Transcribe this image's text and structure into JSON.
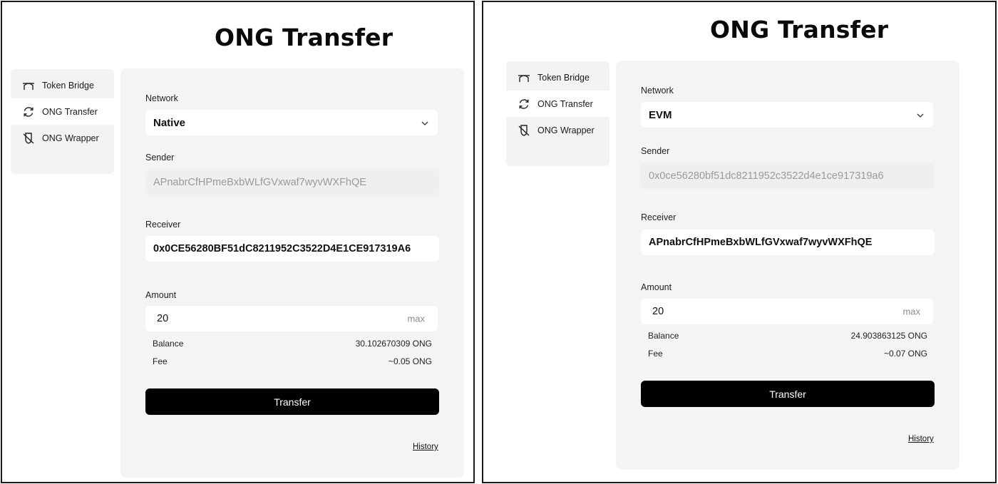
{
  "panels": [
    {
      "title": "ONG Transfer",
      "sidebar": [
        {
          "label": "Token Bridge",
          "icon": "bridge-icon"
        },
        {
          "label": "ONG Transfer",
          "icon": "refresh-icon"
        },
        {
          "label": "ONG Wrapper",
          "icon": "wrapper-icon"
        }
      ],
      "network_label": "Network",
      "network_value": "Native",
      "sender_label": "Sender",
      "sender_value": "APnabrCfHPmeBxbWLfGVxwaf7wyvWXFhQE",
      "receiver_label": "Receiver",
      "receiver_value": "0x0CE56280BF51dC8211952C3522D4E1CE917319A6",
      "amount_label": "Amount",
      "amount_value": "20",
      "max_label": "max",
      "balance_label": "Balance",
      "balance_value": "30.102670309 ONG",
      "fee_label": "Fee",
      "fee_value": "~0.05 ONG",
      "transfer_label": "Transfer",
      "history_label": "History"
    },
    {
      "title": "ONG Transfer",
      "sidebar": [
        {
          "label": "Token Bridge",
          "icon": "bridge-icon"
        },
        {
          "label": "ONG Transfer",
          "icon": "refresh-icon"
        },
        {
          "label": "ONG Wrapper",
          "icon": "wrapper-icon"
        }
      ],
      "network_label": "Network",
      "network_value": "EVM",
      "sender_label": "Sender",
      "sender_value": "0x0ce56280bf51dc8211952c3522d4e1ce917319a6",
      "receiver_label": "Receiver",
      "receiver_value": "APnabrCfHPmeBxbWLfGVxwaf7wyvWXFhQE",
      "amount_label": "Amount",
      "amount_value": "20",
      "max_label": "max",
      "balance_label": "Balance",
      "balance_value": "24.903863125 ONG",
      "fee_label": "Fee",
      "fee_value": "~0.07 ONG",
      "transfer_label": "Transfer",
      "history_label": "History"
    }
  ]
}
